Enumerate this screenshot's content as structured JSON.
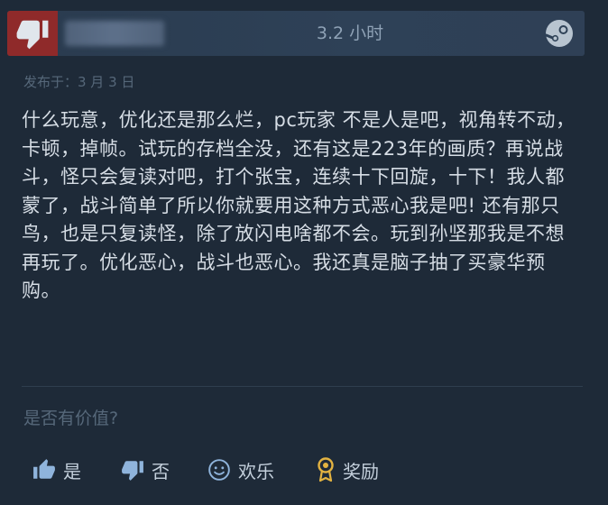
{
  "review": {
    "hours": "3.2 小时",
    "posted": "发布于：3 月 3 日",
    "text": "什么玩意，优化还是那么烂，pc玩家 不是人是吧，视角转不动，卡顿，掉帧。试玩的存档全没，还有这是223年的画质？再说战斗，怪只会复读对吧，打个张宝，连续十下回旋，十下！我人都蒙了，战斗简单了所以你就要用这种方式恶心我是吧! 还有那只鸟，也是只复读怪，除了放闪电啥都不会。玩到孙坚那我是不想再玩了。优化恶心，战斗也恶心。我还真是脑子抽了买豪华预购。",
    "recommendation": "not-recommended"
  },
  "helpful": {
    "question": "是否有价值?",
    "yes_label": "是",
    "no_label": "否",
    "funny_label": "欢乐",
    "award_label": "奖励"
  },
  "colors": {
    "thumb_bg": "#8f2a2a",
    "thumb_icon": "#e0e6ec",
    "text": "#d6dde5",
    "muted": "#56687a"
  },
  "icons": {
    "recommendation": "thumbs-down-icon",
    "platform": "steam-logo-icon",
    "yes": "thumbs-up-icon",
    "no": "thumbs-down-icon",
    "funny": "smiley-icon",
    "award": "award-icon"
  }
}
